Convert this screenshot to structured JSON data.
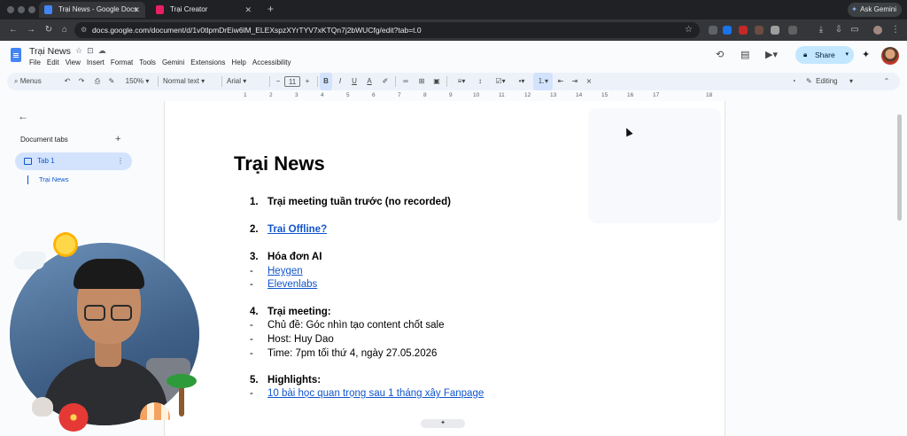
{
  "browser": {
    "tabs": [
      {
        "title": "Trại News - Google Docs",
        "active": true,
        "color": "#4285f4"
      },
      {
        "title": "Trại Creator",
        "active": false,
        "color": "#e91e63"
      }
    ],
    "ask_gemini": "Ask Gemini",
    "url": "docs.google.com/document/d/1v0tlpmDrEiw6lM_ELEXspzXYrTYV7xKTQn7j2bWUCfg/edit?tab=t.0"
  },
  "docs": {
    "title": "Trại News",
    "menu": [
      "File",
      "Edit",
      "View",
      "Insert",
      "Format",
      "Tools",
      "Gemini",
      "Extensions",
      "Help",
      "Accessibility"
    ],
    "share_label": "Share",
    "toolbar": {
      "menus_label": "Menus",
      "zoom": "150%",
      "style": "Normal text",
      "font": "Arial",
      "font_size": "11",
      "mode": "Editing"
    },
    "ruler": [
      "1",
      "2",
      "3",
      "4",
      "5",
      "6",
      "7",
      "8",
      "9",
      "10",
      "11",
      "12",
      "13",
      "14",
      "15",
      "16",
      "17",
      "18"
    ]
  },
  "sidebar": {
    "heading": "Document tabs",
    "tab_label": "Tab 1",
    "outline_item": "Trại News"
  },
  "document": {
    "heading": "Trại News",
    "lines": [
      {
        "num": "1.",
        "text": "Trại meeting tuần trước (no recorded)",
        "style": "bold"
      },
      {
        "num": "2.",
        "text": "Trai Offline?",
        "style": "bold-link"
      },
      {
        "num": "3.",
        "text": "Hóa đơn AI",
        "style": "bold"
      },
      {
        "num": "-",
        "text": "Heygen",
        "style": "link"
      },
      {
        "num": "-",
        "text": "Elevenlabs",
        "style": "link"
      },
      {
        "num": "4.",
        "text": "Trại meeting:",
        "style": "bold"
      },
      {
        "num": "-",
        "text": "Chủ đề: Góc nhìn tạo content chốt sale",
        "style": "normal"
      },
      {
        "num": "-",
        "text": "Host: Huy Dao",
        "style": "normal"
      },
      {
        "num": "-",
        "text": "Time: 7pm tối thứ 4, ngày 27.05.2026",
        "style": "normal"
      },
      {
        "num": "5.",
        "text": "Highlights:",
        "style": "bold"
      },
      {
        "num": "-",
        "text": "10 bài học quan trọng sau 1 tháng xây Fanpage",
        "style": "link"
      }
    ]
  },
  "colors": {
    "accent": "#0b57d0",
    "link": "#1155cc",
    "share_bg": "#c2e7ff"
  }
}
